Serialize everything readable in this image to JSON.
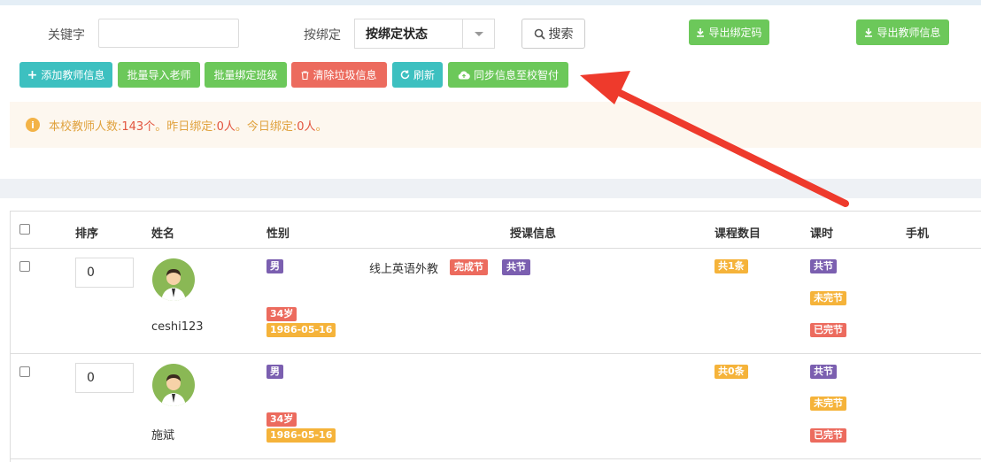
{
  "filters": {
    "keyword_label": "关键字",
    "keyword_value": "",
    "bind_label": "按绑定",
    "bind_select_value": "按绑定状态",
    "search_label": "搜索",
    "export_bind_code_label": "导出绑定码",
    "export_teacher_label": "导出教师信息"
  },
  "toolbar": {
    "add_teacher": "添加教师信息",
    "batch_import": "批量导入老师",
    "batch_bind_class": "批量绑定班级",
    "clear_garbage": "清除垃圾信息",
    "refresh": "刷新",
    "sync": "同步信息至校智付"
  },
  "notice": {
    "prefix": "本校教师人数:",
    "total": "143个",
    "mid1": "。昨日绑定:",
    "yesterday": "0人",
    "mid2": "。今日绑定:",
    "today": "0人",
    "suffix": "。"
  },
  "table": {
    "headers": [
      "排序",
      "姓名",
      "性别",
      "授课信息",
      "课程数目",
      "课时",
      "手机"
    ],
    "rows": [
      {
        "order": "0",
        "name": "ceshi123",
        "gender": "男",
        "age": "34岁",
        "birth": "1986-05-16",
        "course_name": "线上英语外教",
        "course_tag1": "完成节",
        "course_tag2": "共节",
        "course_count": "共1条",
        "hours_total": "共节",
        "hours_unfinished": "未完节",
        "hours_finished": "已完节"
      },
      {
        "order": "0",
        "name": "施斌",
        "gender": "男",
        "age": "34岁",
        "birth": "1986-05-16",
        "course_count": "共0条",
        "hours_total": "共节",
        "hours_unfinished": "未完节",
        "hours_finished": "已完节"
      }
    ]
  },
  "colors": {
    "teal": "#3dc0c0",
    "green": "#6cc85a",
    "red": "#ec6b5e",
    "purple": "#7b5fb0",
    "orange": "#f5b33a",
    "arrow": "#ee3a2c"
  }
}
